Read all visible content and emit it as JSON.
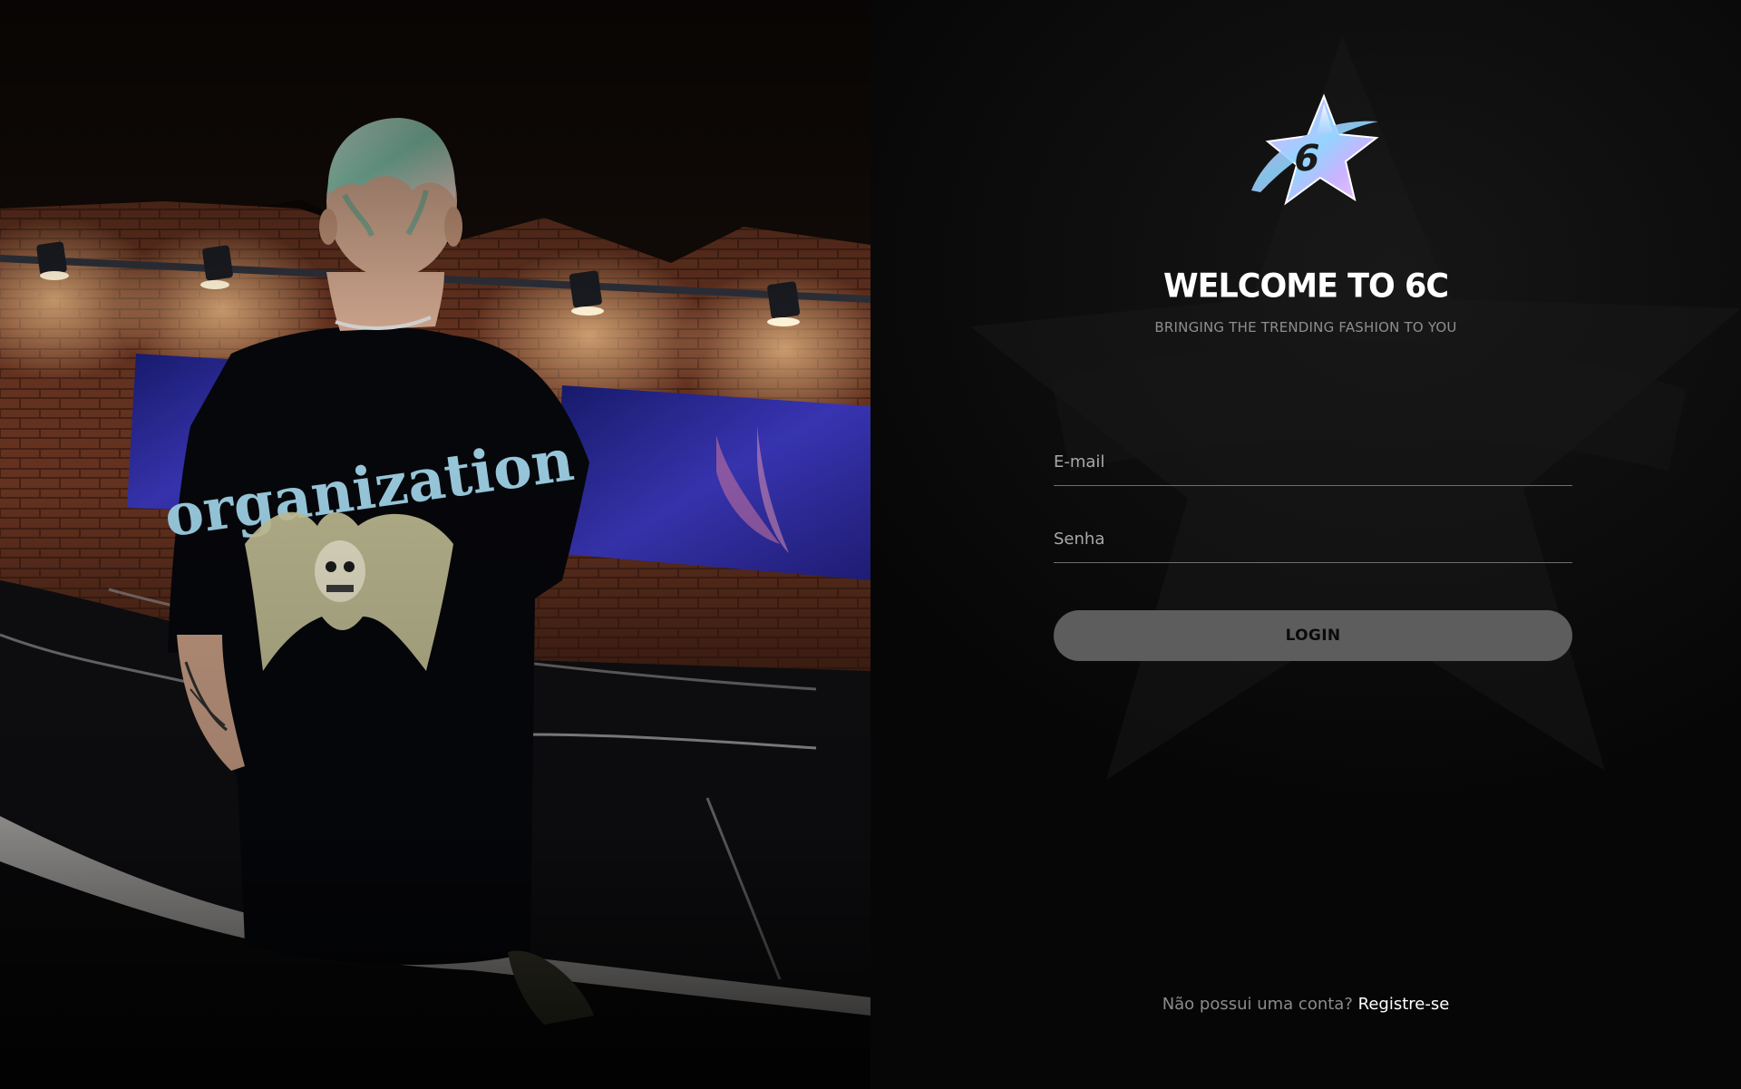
{
  "colors": {
    "background": "#070707",
    "panel_text": "#ffffff",
    "muted_text": "#8e8e8e",
    "field_line": "#6f6f6f",
    "button_bg": "#5d5d5d",
    "button_text": "#0b0b0b",
    "logo_gradient": [
      "#f4a6ff",
      "#8fd6ff",
      "#c9b3ff"
    ]
  },
  "hero": {
    "image": "fashion-model-photo",
    "shirt_print": "organization"
  },
  "logo": {
    "icon": "6c-star-logo-icon"
  },
  "login": {
    "title": "WELCOME TO 6C",
    "subtitle": "BRINGING THE TRENDING FASHION TO YOU",
    "email": {
      "placeholder": "E-mail",
      "value": ""
    },
    "password": {
      "placeholder": "Senha",
      "value": ""
    },
    "submit_label": "LOGIN"
  },
  "register": {
    "prompt": "Não possui uma conta?",
    "link_label": "Registre-se"
  }
}
